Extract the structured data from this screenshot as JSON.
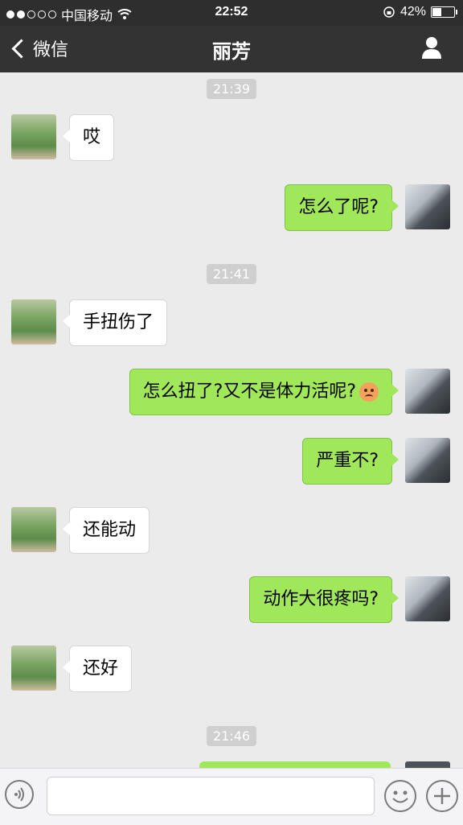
{
  "status_bar": {
    "carrier": "中国移动",
    "time": "22:52",
    "battery": "42%",
    "battery_level": 0.42
  },
  "nav": {
    "back_label": "微信",
    "title": "丽芳"
  },
  "timestamps": [
    "21:39",
    "21:41",
    "21:46"
  ],
  "messages": [
    {
      "side": "left",
      "text": "哎"
    },
    {
      "side": "right",
      "text": "怎么了呢?"
    },
    {
      "side": "left",
      "text": "手扭伤了"
    },
    {
      "side": "right",
      "text": "怎么扭了?又不是体力活呢?",
      "emoji": "angry-face"
    },
    {
      "side": "right",
      "text": "严重不?"
    },
    {
      "side": "left",
      "text": "还能动"
    },
    {
      "side": "right",
      "text": "动作大很疼吗?"
    },
    {
      "side": "left",
      "text": "还好"
    }
  ],
  "input": {
    "placeholder": ""
  },
  "colors": {
    "my_bubble": "#a0e75a",
    "nav_bg": "#333333"
  }
}
